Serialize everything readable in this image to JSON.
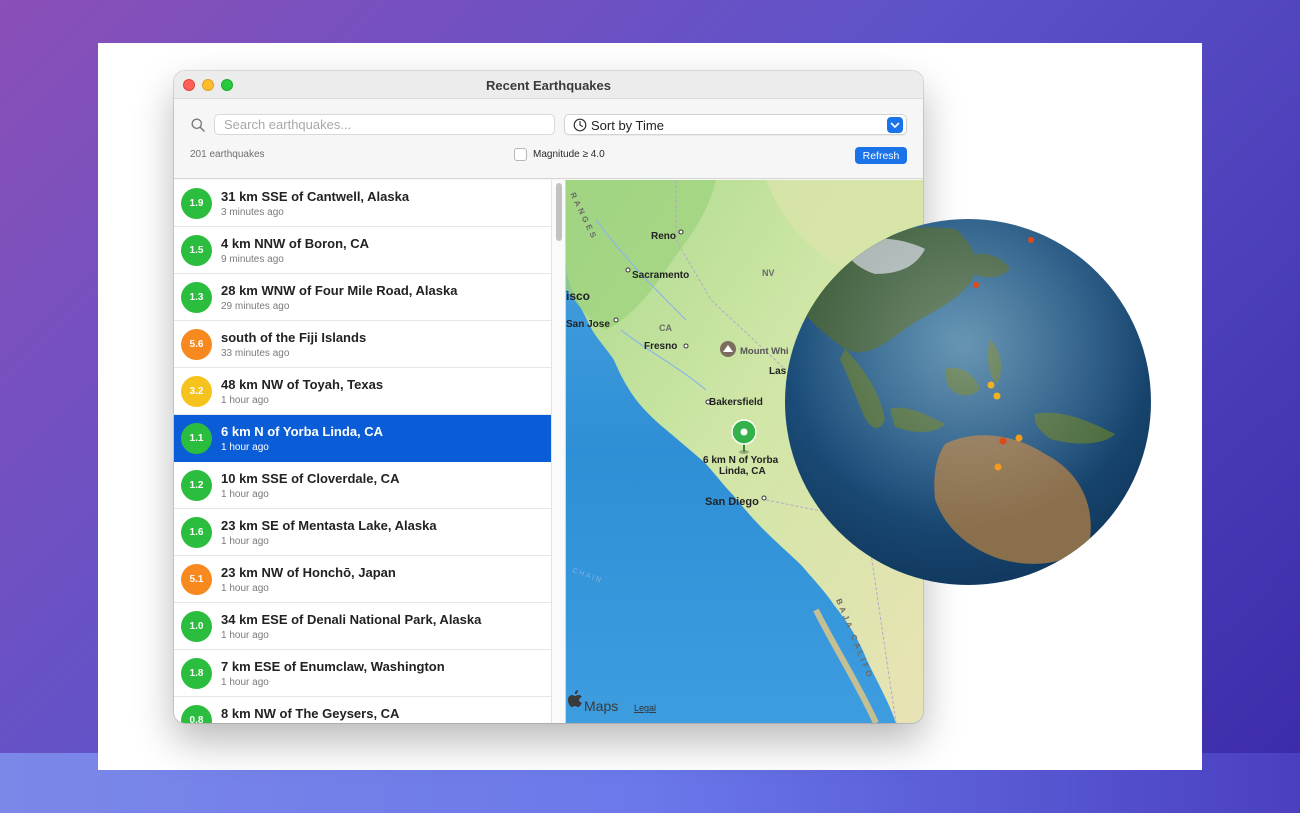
{
  "window": {
    "title": "Recent Earthquakes"
  },
  "toolbar": {
    "search_placeholder": "Search earthquakes...",
    "sort_label": "Sort by Time",
    "count_label": "201 earthquakes",
    "magnitude_filter_label": "Magnitude ≥ 4.0",
    "magnitude_filter_checked": false,
    "refresh_label": "Refresh"
  },
  "colors": {
    "accent": "#1a73e8",
    "selection": "#0a5dd6",
    "mag_green": "#2bbd3e",
    "mag_yellow": "#f6c31c",
    "mag_orange": "#f7891f"
  },
  "quakes": [
    {
      "mag": "1.9",
      "title": "31 km SSE of Cantwell, Alaska",
      "time": "3 minutes ago",
      "level": "green"
    },
    {
      "mag": "1.5",
      "title": "4 km NNW of Boron, CA",
      "time": "9 minutes ago",
      "level": "green"
    },
    {
      "mag": "1.3",
      "title": "28 km WNW of Four Mile Road, Alaska",
      "time": "29 minutes ago",
      "level": "green"
    },
    {
      "mag": "5.6",
      "title": "south of the Fiji Islands",
      "time": "33 minutes ago",
      "level": "orange"
    },
    {
      "mag": "3.2",
      "title": "48 km NW of Toyah, Texas",
      "time": "1 hour ago",
      "level": "yellow"
    },
    {
      "mag": "1.1",
      "title": "6 km N of Yorba Linda, CA",
      "time": "1 hour ago",
      "level": "green",
      "selected": true
    },
    {
      "mag": "1.2",
      "title": "10 km SSE of Cloverdale, CA",
      "time": "1 hour ago",
      "level": "green"
    },
    {
      "mag": "1.6",
      "title": "23 km SE of Mentasta Lake, Alaska",
      "time": "1 hour ago",
      "level": "green"
    },
    {
      "mag": "5.1",
      "title": "23 km NW of Honchō, Japan",
      "time": "1 hour ago",
      "level": "orange"
    },
    {
      "mag": "1.0",
      "title": "34 km ESE of Denali National Park, Alaska",
      "time": "1 hour ago",
      "level": "green"
    },
    {
      "mag": "1.8",
      "title": "7 km ESE of Enumclaw, Washington",
      "time": "1 hour ago",
      "level": "green"
    },
    {
      "mag": "0.8",
      "title": "8 km NW of The Geysers, CA",
      "time": "",
      "level": "green"
    }
  ],
  "map": {
    "labels": {
      "ranges": "RANGES",
      "reno": "Reno",
      "sacramento": "Sacramento",
      "nv": "NV",
      "francisco": "isco",
      "san_jose": "San Jose",
      "ca": "CA",
      "fresno": "Fresno",
      "mount_whitney": "Mount Whi",
      "las": "Las",
      "bakersfield": "Bakersfield",
      "pin_line1": "6 km N of Yorba",
      "pin_line2": "Linda, CA",
      "san_diego": "San Diego",
      "chain": "CHAIN",
      "baja": "BAJA CALIFO",
      "maps": "Maps",
      "legal": "Legal"
    }
  }
}
